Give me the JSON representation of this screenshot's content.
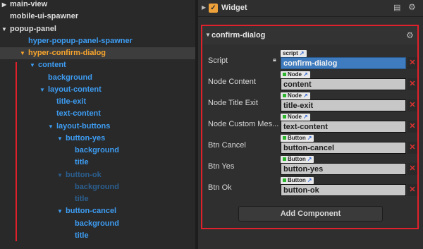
{
  "hierarchy": {
    "nodes": [
      {
        "label": "main-view",
        "color": "white",
        "indent": 14,
        "expander": "right"
      },
      {
        "label": "mobile-ui-spawner",
        "color": "white",
        "indent": 14,
        "expander": "none"
      },
      {
        "label": "popup-panel",
        "color": "white",
        "indent": 14,
        "expander": "down"
      },
      {
        "label": "hyper-popup-panel-spawner",
        "color": "blue",
        "indent": 40,
        "expander": "none"
      },
      {
        "label": "hyper-confirm-dialog",
        "color": "orange",
        "indent": 40,
        "expander": "down",
        "selected": true
      },
      {
        "label": "content",
        "color": "blue",
        "indent": 54,
        "expander": "down"
      },
      {
        "label": "background",
        "color": "blue",
        "indent": 68,
        "expander": "none"
      },
      {
        "label": "layout-content",
        "color": "blue",
        "indent": 68,
        "expander": "down"
      },
      {
        "label": "title-exit",
        "color": "blue",
        "indent": 80,
        "expander": "none"
      },
      {
        "label": "text-content",
        "color": "blue",
        "indent": 80,
        "expander": "none"
      },
      {
        "label": "layout-buttons",
        "color": "blue",
        "indent": 80,
        "expander": "down"
      },
      {
        "label": "button-yes",
        "color": "blue",
        "indent": 93,
        "expander": "down"
      },
      {
        "label": "background",
        "color": "blue",
        "indent": 106,
        "expander": "none"
      },
      {
        "label": "title",
        "color": "blue",
        "indent": 106,
        "expander": "none"
      },
      {
        "label": "button-ok",
        "color": "dim",
        "indent": 93,
        "expander": "down"
      },
      {
        "label": "background",
        "color": "dim",
        "indent": 106,
        "expander": "none"
      },
      {
        "label": "title",
        "color": "dim",
        "indent": 106,
        "expander": "none"
      },
      {
        "label": "button-cancel",
        "color": "blue",
        "indent": 93,
        "expander": "down"
      },
      {
        "label": "background",
        "color": "blue",
        "indent": 106,
        "expander": "none"
      },
      {
        "label": "title",
        "color": "blue",
        "indent": 106,
        "expander": "none"
      }
    ]
  },
  "inspector": {
    "widget": {
      "title": "Widget",
      "checked": true
    },
    "component": {
      "title": "confirm-dialog",
      "properties": [
        {
          "label": "Script",
          "tag": "script",
          "value": "confirm-dialog",
          "kind": "script",
          "locked": true
        },
        {
          "label": "Node Content",
          "tag": "Node",
          "value": "content",
          "kind": "node"
        },
        {
          "label": "Node Title Exit",
          "tag": "Node",
          "value": "title-exit",
          "kind": "node"
        },
        {
          "label": "Node Custom Mes...",
          "tag": "Node",
          "value": "text-content",
          "kind": "node"
        },
        {
          "label": "Btn Cancel",
          "tag": "Button",
          "value": "button-cancel",
          "kind": "button"
        },
        {
          "label": "Btn Yes",
          "tag": "Button",
          "value": "button-yes",
          "kind": "button"
        },
        {
          "label": "Btn Ok",
          "tag": "Button",
          "value": "button-ok",
          "kind": "button"
        }
      ],
      "add_component_label": "Add Component"
    }
  },
  "colors": {
    "white": "#dedede",
    "blue": "#3d9cf2",
    "orange": "#f8a52d",
    "dim": "#2b5f8f",
    "highlight_red": "#e0202a",
    "script_field": "#3e7bbf"
  },
  "icons": {
    "widget_checkbox": "checkmark-icon",
    "lock": "lock-icon",
    "settings": "gear-icon",
    "docs": "book-icon",
    "remove": "close-icon",
    "node_tag_marker": "link-icon"
  }
}
